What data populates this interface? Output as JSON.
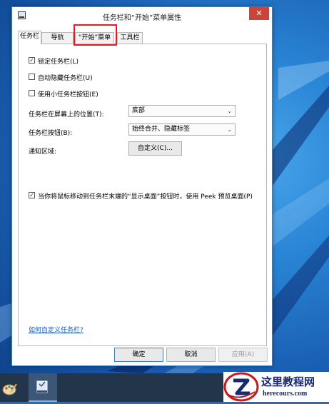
{
  "window": {
    "title": "任务栏和“开始”菜单属性",
    "close_glyph": "✕",
    "icon": "taskbar-properties-icon"
  },
  "tabs": [
    {
      "label": "任务栏",
      "active": true
    },
    {
      "label": "导航",
      "active": false
    },
    {
      "label": "“开始”菜单",
      "active": false,
      "highlighted": true
    },
    {
      "label": "工具栏",
      "active": false
    }
  ],
  "options": {
    "lock_taskbar": {
      "label": "锁定任务栏(L)",
      "checked": true
    },
    "auto_hide": {
      "label": "自动隐藏任务栏(U)",
      "checked": false
    },
    "small_buttons": {
      "label": "使用小任务栏按钮(E)",
      "checked": false
    },
    "location": {
      "label": "任务栏在屏幕上的位置(T):",
      "value": "底部"
    },
    "buttons": {
      "label": "任务栏按钮(B):",
      "value": "始终合并、隐藏标签"
    },
    "notification": {
      "label": "通知区域:",
      "button": "自定义(C)..."
    },
    "peek": {
      "label": "当你将鼠标移动到任务栏末端的“显示桌面”按钮时，使用 Peek 预览桌面(P)",
      "checked": true
    }
  },
  "help_link": "如何自定义任务栏?",
  "footer": {
    "ok": "确定",
    "cancel": "取消",
    "apply": "应用(A)"
  },
  "taskbar": {
    "items": [
      "paint-icon",
      "taskbar-properties-icon"
    ]
  },
  "watermark": {
    "title": "这里教程网",
    "url": "herecours.com"
  },
  "colors": {
    "highlight_box": "#e01c24",
    "close_button": "#c7453a",
    "link": "#1a5fb4",
    "desktop": "#1e6fc1"
  }
}
